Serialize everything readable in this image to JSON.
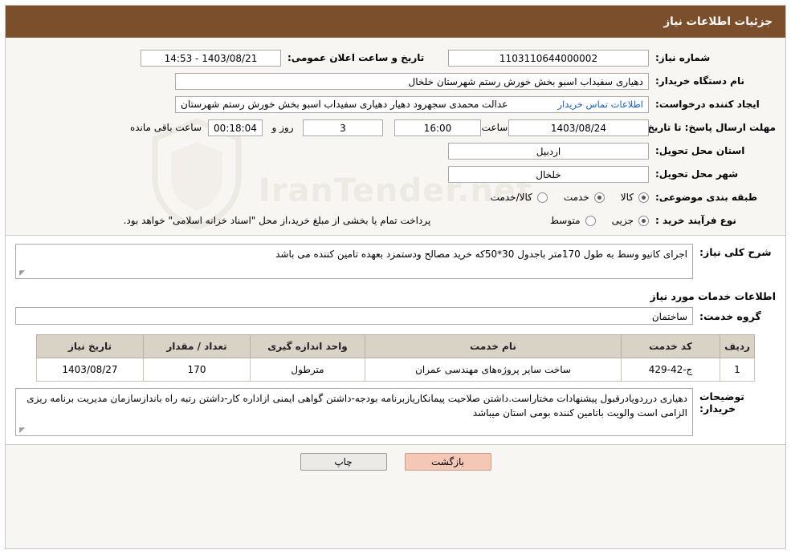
{
  "header": {
    "title": "جزئیات اطلاعات نیاز"
  },
  "watermark": {
    "text": "IranTender.net",
    "shield_icon": "shield-icon"
  },
  "fields": {
    "need_number": {
      "label": "شماره نیاز:",
      "value": "1103110644000002"
    },
    "public_announce_datetime": {
      "label": "تاریخ و ساعت اعلان عمومی:",
      "value": "1403/08/21 - 14:53"
    },
    "buyer_org": {
      "label": "نام دستگاه خریدار:",
      "value": "دهیاری سفیداب اسبو بخش خورش رستم شهرستان خلخال"
    },
    "requester": {
      "label": "ایجاد کننده درخواست:",
      "value": "عدالت محمدی سجهرود دهیار دهیاری سفیداب اسبو بخش خورش رستم شهرستان",
      "link": "اطلاعات تماس خریدار"
    },
    "deadline": {
      "label": "مهلت ارسال پاسخ: تا تاریخ:",
      "date": "1403/08/24",
      "time_label": "ساعت",
      "time": "16:00",
      "days": "3",
      "days_label": "روز و",
      "remaining": "00:18:04",
      "remaining_label": "ساعت باقی مانده"
    },
    "province": {
      "label": "استان محل تحویل:",
      "value": "اردبیل"
    },
    "city": {
      "label": "شهر محل تحویل:",
      "value": "خلخال"
    },
    "category": {
      "label": "طبقه بندی موضوعی:",
      "options": [
        "کالا",
        "خدمت",
        "کالا/خدمت"
      ],
      "selected": "کالا"
    },
    "purchase_type": {
      "label": "نوع فرآیند خرید :",
      "options": [
        "جزیی",
        "متوسط"
      ],
      "selected": "جزیی",
      "note": "پرداخت تمام یا بخشی از مبلغ خرید،از محل \"اسناد خزانه اسلامی\" خواهد بود."
    }
  },
  "general_description": {
    "label": "شرح کلی نیاز:",
    "value": "اجرای کانیو وسط به طول 170متر باجدول 30*50که خرید مصالح ودستمزد بعهده تامین کننده می باشد"
  },
  "services_section": {
    "title": "اطلاعات خدمات مورد نیاز",
    "service_group_label": "گروه خدمت:",
    "service_group_value": "ساختمان"
  },
  "table": {
    "headers": [
      "ردیف",
      "کد خدمت",
      "نام خدمت",
      "واحد اندازه گیری",
      "تعداد / مقدار",
      "تاریخ نیاز"
    ],
    "rows": [
      [
        "1",
        "ج-42-429",
        "ساخت سایر پروژه‌های مهندسی عمران",
        "مترطول",
        "170",
        "1403/08/27"
      ]
    ]
  },
  "buyer_notes": {
    "label": "توضیحات خریدار:",
    "value": "دهیاری درردویادرقبول پیشنهادات مختاراست.داشتن صلاحیت پیمانکاریازبرنامه بودجه-داشتن گواهی ایمنی ازاداره کار-داشتن رتبه راه باندازسازمان مدیریت برنامه ریزی الزامی است والویت باتامین کننده بومی استان میباشد"
  },
  "footer": {
    "print_label": "چاپ",
    "back_label": "بازگشت"
  }
}
